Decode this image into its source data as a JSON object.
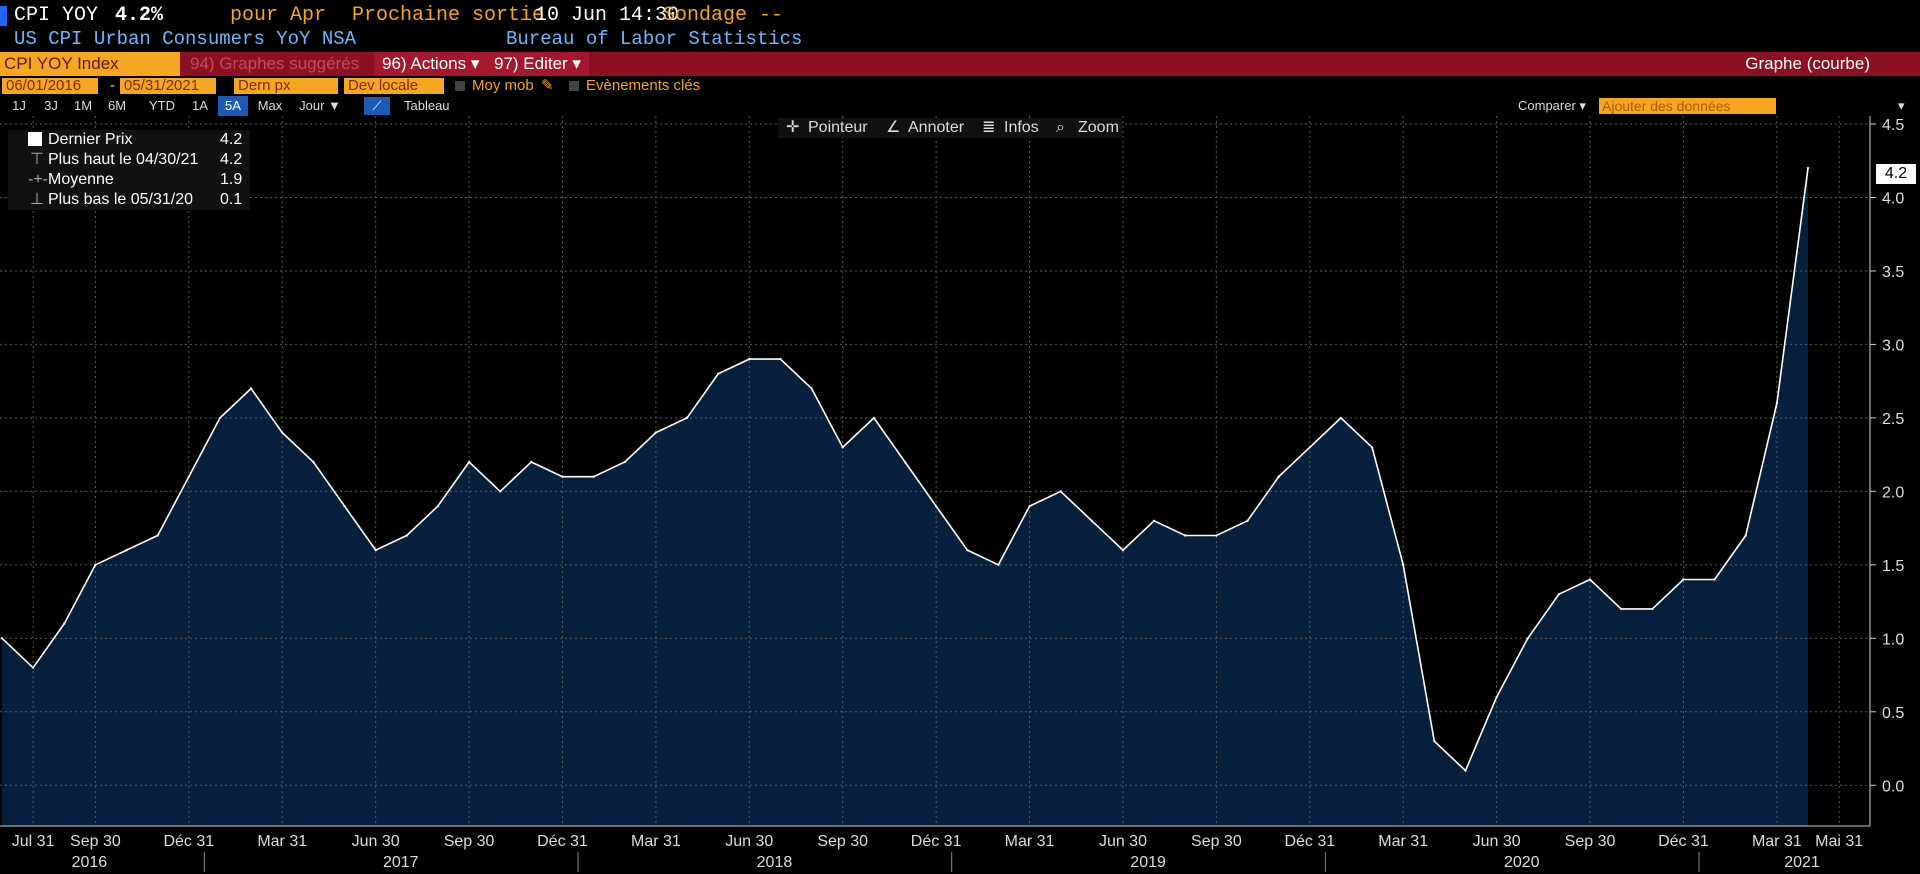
{
  "header": {
    "ticker": "CPI YOY",
    "last_value": "4.2%",
    "period": "pour Apr",
    "next_release_label": "Prochaine sortie",
    "next_release_date": "10 Jun 14:30",
    "survey_label": "Sondage --",
    "description": "US CPI Urban Consumers YoY NSA",
    "source": "Bureau of Labor Statistics"
  },
  "menubar": {
    "security": "CPI YOY Index",
    "suggested": "94) Graphes suggérés",
    "actions": "96) Actions ▾",
    "edit": "97) Editer ▾",
    "chart_type": "Graphe (courbe)"
  },
  "controls": {
    "start_date": "06/01/2016",
    "end_date": "05/31/2021",
    "separator": "-",
    "price_field": "Dern px",
    "currency": "Dev locale",
    "moving_avg": "Moy mob",
    "key_events": "Evènements clés"
  },
  "periods": [
    "1J",
    "3J",
    "1M",
    "6M",
    "YTD",
    "1A",
    "5A",
    "Max",
    "Jour ▼"
  ],
  "active_period": "5A",
  "table_label": "Tableau",
  "compare_label": "Comparer ▾",
  "add_data_placeholder": "Ajouter des données",
  "tools": {
    "pointer": "Pointeur",
    "annotate": "Annoter",
    "info": "Infos",
    "zoom": "Zoom"
  },
  "legend": [
    {
      "name": "Dernier Prix",
      "value": "4.2"
    },
    {
      "name": "Plus haut le 04/30/21",
      "value": "4.2"
    },
    {
      "name": "Moyenne",
      "value": "1.9"
    },
    {
      "name": "Plus bas le 05/31/20",
      "value": "0.1"
    }
  ],
  "last_tag": "4.2",
  "colors": {
    "accent": "#f5a623",
    "menu_red": "#8a1022",
    "area_fill": "#061f3d",
    "line": "#ffffff",
    "active_period": "#1e5ab4"
  },
  "chart_data": {
    "type": "area",
    "title": "",
    "xlabel": "",
    "ylabel": "",
    "ylim": [
      -0.25,
      4.5
    ],
    "y_ticks": [
      "0.0",
      "0.5",
      "1.0",
      "1.5",
      "2.0",
      "2.5",
      "3.0",
      "3.5",
      "4.0",
      "4.5"
    ],
    "x_tick_labels": [
      "Jul 31",
      "Sep 30",
      "Déc 31",
      "Mar 31",
      "Jun 30",
      "Sep 30",
      "Déc 31",
      "Mar 31",
      "Jun 30",
      "Sep 30",
      "Déc 31",
      "Mar 31",
      "Jun 30",
      "Sep 30",
      "Déc 31",
      "Mar 31",
      "Jun 30",
      "Sep 30",
      "Déc 31",
      "Mar 31",
      "Mai 31"
    ],
    "year_labels": [
      "2016",
      "2017",
      "2018",
      "2019",
      "2020",
      "2021"
    ],
    "grid": true,
    "x": [
      "2016-06",
      "2016-07",
      "2016-08",
      "2016-09",
      "2016-10",
      "2016-11",
      "2016-12",
      "2017-01",
      "2017-02",
      "2017-03",
      "2017-04",
      "2017-05",
      "2017-06",
      "2017-07",
      "2017-08",
      "2017-09",
      "2017-10",
      "2017-11",
      "2017-12",
      "2018-01",
      "2018-02",
      "2018-03",
      "2018-04",
      "2018-05",
      "2018-06",
      "2018-07",
      "2018-08",
      "2018-09",
      "2018-10",
      "2018-11",
      "2018-12",
      "2019-01",
      "2019-02",
      "2019-03",
      "2019-04",
      "2019-05",
      "2019-06",
      "2019-07",
      "2019-08",
      "2019-09",
      "2019-10",
      "2019-11",
      "2019-12",
      "2020-01",
      "2020-02",
      "2020-03",
      "2020-04",
      "2020-05",
      "2020-06",
      "2020-07",
      "2020-08",
      "2020-09",
      "2020-10",
      "2020-11",
      "2020-12",
      "2021-01",
      "2021-02",
      "2021-03",
      "2021-04"
    ],
    "series": [
      {
        "values": [
          1.0,
          0.8,
          1.1,
          1.5,
          1.6,
          1.7,
          2.1,
          2.5,
          2.7,
          2.4,
          2.2,
          1.9,
          1.6,
          1.7,
          1.9,
          2.2,
          2.0,
          2.2,
          2.1,
          2.1,
          2.2,
          2.4,
          2.5,
          2.8,
          2.9,
          2.9,
          2.7,
          2.3,
          2.5,
          2.2,
          1.9,
          1.6,
          1.5,
          1.9,
          2.0,
          1.8,
          1.6,
          1.8,
          1.7,
          1.7,
          1.8,
          2.1,
          2.3,
          2.5,
          2.3,
          1.5,
          0.3,
          0.1,
          0.6,
          1.0,
          1.3,
          1.4,
          1.2,
          1.2,
          1.4,
          1.4,
          1.7,
          2.6,
          4.2
        ]
      }
    ]
  }
}
